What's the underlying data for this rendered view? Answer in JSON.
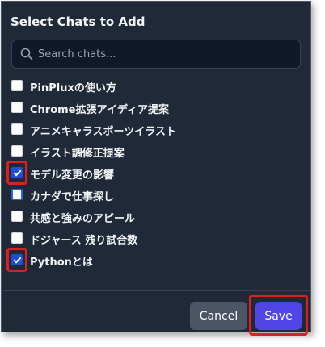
{
  "dialog": {
    "title": "Select Chats to Add",
    "search": {
      "placeholder": "Search chats...",
      "value": "",
      "icon": "search-icon"
    },
    "chats": [
      {
        "label": "PinPluxの使い方",
        "checked": false,
        "highlighted": false
      },
      {
        "label": "Chrome拡張アイディア提案",
        "checked": false,
        "highlighted": false
      },
      {
        "label": "アニメキャラスポーツイラスト",
        "checked": false,
        "highlighted": false
      },
      {
        "label": "イラスト調修正提案",
        "checked": false,
        "highlighted": false
      },
      {
        "label": "モデル変更の影響",
        "checked": true,
        "highlighted": true
      },
      {
        "label": "カナダで仕事探し",
        "checked": false,
        "highlighted": false,
        "focused": true
      },
      {
        "label": "共感と強みのアピール",
        "checked": false,
        "highlighted": false
      },
      {
        "label": "ドジャース 残り試合数",
        "checked": false,
        "highlighted": false
      },
      {
        "label": "Pythonとは",
        "checked": true,
        "highlighted": true
      }
    ],
    "buttons": {
      "cancel_label": "Cancel",
      "save_label": "Save",
      "save_highlighted": true
    },
    "colors": {
      "background": "#1f2937",
      "accent": "#4f46e5",
      "checkbox_checked": "#1d4ed8",
      "highlight": "#e11d1d"
    }
  }
}
